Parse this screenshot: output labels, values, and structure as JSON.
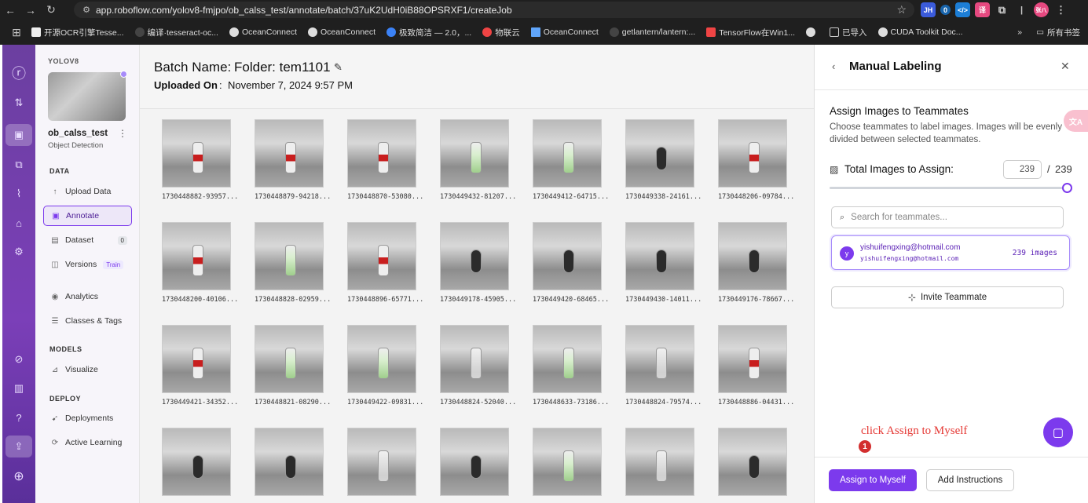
{
  "browser": {
    "url": "app.roboflow.com/yolov8-fmjpo/ob_calss_test/annotate/batch/37uK2UdH0iB88OPSRXF1/createJob",
    "bookmarks": [
      "开源OCR引擎Tesse...",
      "编译·tesseract-oc...",
      "OceanConnect",
      "OceanConnect",
      "极致简洁 — 2.0，...",
      "物联云",
      "OceanConnect",
      "getlantern/lantern:...",
      "TensorFlow在Win1...",
      "已导入",
      "CUDA Toolkit Doc..."
    ],
    "all_bookmarks": "所有书签",
    "ext_labels": [
      "JH",
      "0",
      "</>",
      "译",
      "张八"
    ]
  },
  "sidebar": {
    "workspace_label": "YOLOV8",
    "project_name": "ob_calss_test",
    "project_type": "Object Detection",
    "sections": {
      "data": "DATA",
      "models": "MODELS",
      "deploy": "DEPLOY"
    },
    "items": {
      "upload": "Upload Data",
      "annotate": "Annotate",
      "dataset": "Dataset",
      "dataset_badge": "0",
      "versions": "Versions",
      "versions_badge": "Train",
      "analytics": "Analytics",
      "classes": "Classes & Tags",
      "visualize": "Visualize",
      "deployments": "Deployments",
      "active_learning": "Active Learning"
    }
  },
  "header": {
    "batch_label": "Batch Name:",
    "batch_value": "Folder: tem1101",
    "uploaded_label": "Uploaded On",
    "uploaded_colon": ":",
    "uploaded_value": "November 7, 2024 9:57 PM"
  },
  "images": [
    {
      "name": "1730448882-93957...",
      "kind": "red"
    },
    {
      "name": "1730448879-94218...",
      "kind": "red"
    },
    {
      "name": "1730448870-53080...",
      "kind": "red"
    },
    {
      "name": "1730449432-81207...",
      "kind": "green"
    },
    {
      "name": "1730449412-64715...",
      "kind": "green"
    },
    {
      "name": "1730449338-24161...",
      "kind": "black"
    },
    {
      "name": "1730448206-09784...",
      "kind": "red"
    },
    {
      "name": "1730448200-40106...",
      "kind": "red"
    },
    {
      "name": "1730448828-02959...",
      "kind": "green"
    },
    {
      "name": "1730448896-65771...",
      "kind": "red"
    },
    {
      "name": "1730449178-45905...",
      "kind": "black"
    },
    {
      "name": "1730449420-68465...",
      "kind": "black"
    },
    {
      "name": "1730449430-14011...",
      "kind": "black"
    },
    {
      "name": "1730449176-78667...",
      "kind": "black"
    },
    {
      "name": "1730449421-34352...",
      "kind": "red"
    },
    {
      "name": "1730448821-08290...",
      "kind": "green"
    },
    {
      "name": "1730449422-09831...",
      "kind": "green"
    },
    {
      "name": "1730448824-52040...",
      "kind": "clear"
    },
    {
      "name": "1730448633-73186...",
      "kind": "green"
    },
    {
      "name": "1730448824-79574...",
      "kind": "clear"
    },
    {
      "name": "1730448886-04431...",
      "kind": "red"
    },
    {
      "name": "",
      "kind": "black"
    },
    {
      "name": "",
      "kind": "black"
    },
    {
      "name": "",
      "kind": "clear"
    },
    {
      "name": "",
      "kind": "black"
    },
    {
      "name": "",
      "kind": "green"
    },
    {
      "name": "",
      "kind": "clear"
    },
    {
      "name": "",
      "kind": "black"
    }
  ],
  "panel": {
    "title": "Manual Labeling",
    "assign_title": "Assign Images to Teammates",
    "assign_desc": "Choose teammates to label images. Images will be evenly divided between selected teammates.",
    "total_label": "Total Images to Assign:",
    "total_value": "239",
    "slash": "/",
    "total_max": "239",
    "slider_fraction": 1.0,
    "search_placeholder": "Search for teammates...",
    "teammate": {
      "avatar": "y",
      "email": "yishuifengxing@hotmail.com",
      "email_sub": "yishuifengxing@hotmail.com",
      "count": "239 images"
    },
    "invite_label": "Invite Teammate",
    "assign_button": "Assign to Myself",
    "instructions_button": "Add Instructions"
  },
  "annotation": {
    "text": "click Assign to Myself",
    "step": "1"
  },
  "colors": {
    "accent": "#7c3aed",
    "annotation": "#e53935"
  }
}
